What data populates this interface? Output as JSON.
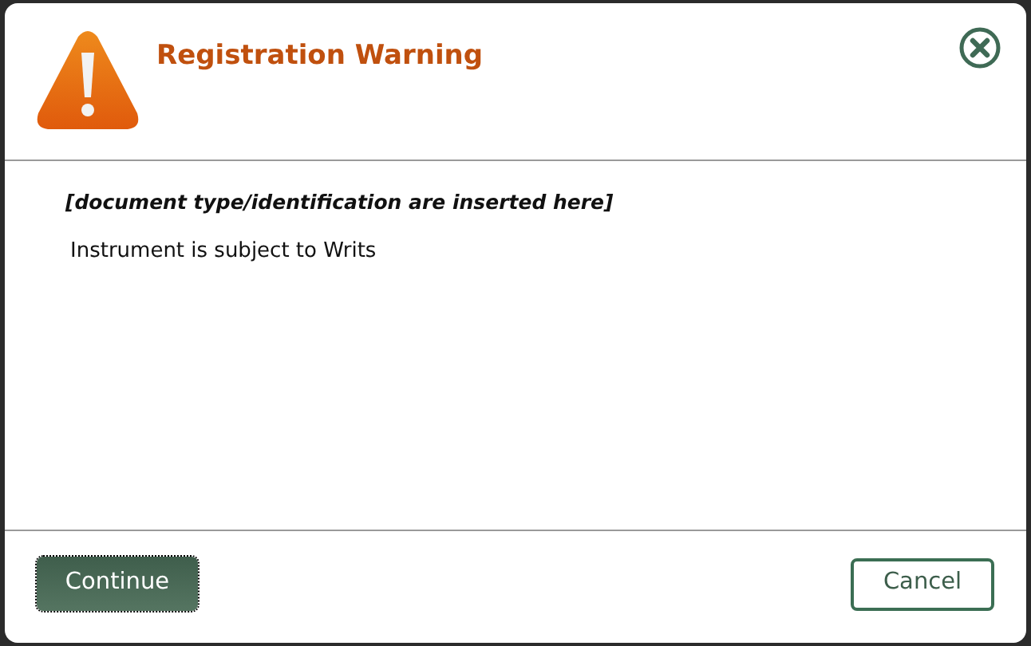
{
  "dialog": {
    "title": "Registration Warning",
    "document_line": "[document type/identification are inserted here]",
    "message": "Instrument is subject to Writs",
    "buttons": [
      {
        "label": "Continue",
        "kind": "primary",
        "focused": true
      },
      {
        "label": "Cancel",
        "kind": "secondary",
        "focused": false
      }
    ]
  }
}
